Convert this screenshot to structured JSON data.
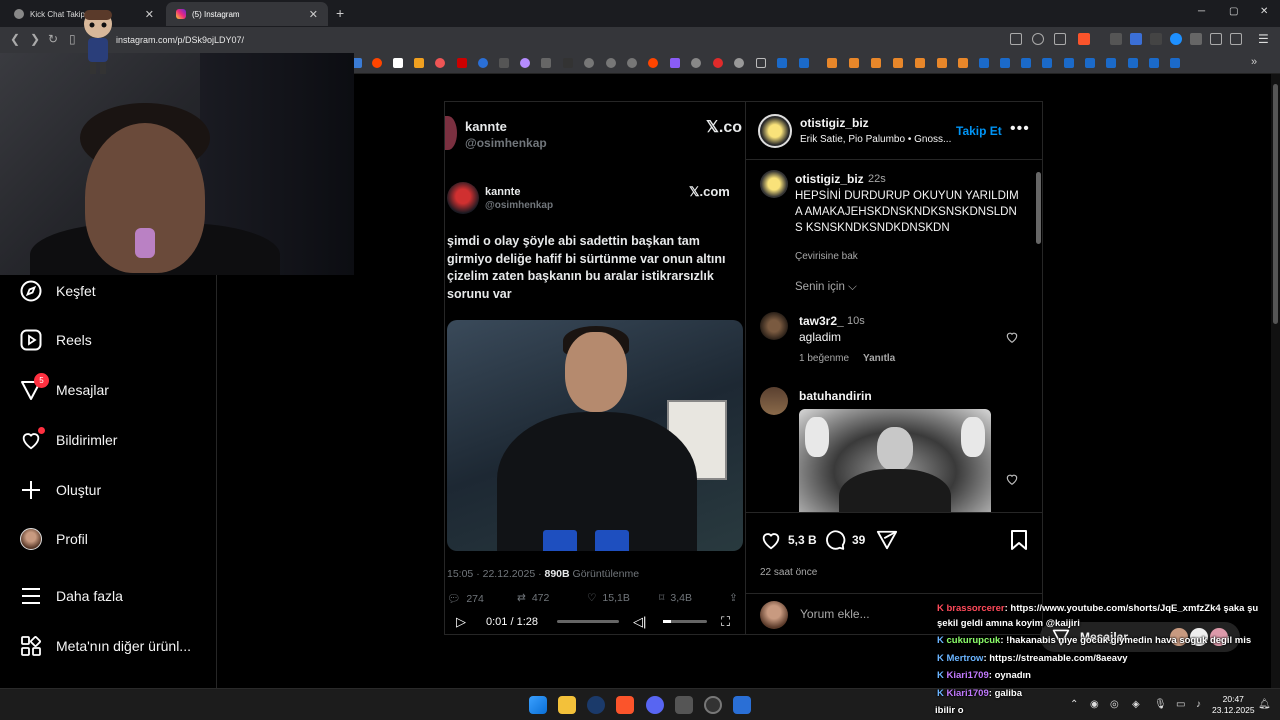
{
  "browser": {
    "tabs": [
      {
        "label": "Kick Chat Takip | W",
        "active": false
      },
      {
        "label": "(5) Instagram",
        "active": true
      }
    ],
    "url": "instagram.com/p/DSk9ojLDY07/",
    "new_tab": "+",
    "win_min": "─",
    "win_max": "▢",
    "win_close": "✕"
  },
  "sidebar": {
    "items": [
      {
        "label": "Keşfet",
        "icon": "compass-icon"
      },
      {
        "label": "Reels",
        "icon": "reels-icon"
      },
      {
        "label": "Mesajlar",
        "icon": "messenger-icon",
        "badge": "5"
      },
      {
        "label": "Bildirimler",
        "icon": "heart-icon"
      },
      {
        "label": "Oluştur",
        "icon": "plus-icon"
      },
      {
        "label": "Profil",
        "icon": "avatar"
      },
      {
        "label": "Daha fazla",
        "icon": "menu-icon"
      },
      {
        "label": "Meta'nın diğer ürünl...",
        "icon": "apps-icon"
      }
    ]
  },
  "media": {
    "top_name": "kannte",
    "top_handle": "@osimhenkap",
    "top_xcom": "𝕏.co",
    "name": "kannte",
    "handle": "@osimhenkap",
    "xcom": "𝕏.com",
    "tweet_text": "şimdi o olay şöyle abi sadettin başkan tam girmiyo deliğe hafif bi sürtünme var onun altını çizelim zaten başkanın bu aralar istikrarsızlık sorunu var",
    "meta_time": "15:05 · 22.12.2025 · ",
    "meta_views": "890B",
    "meta_views_label": " Görüntülenme",
    "stats": {
      "replies": "274",
      "retweets": "472",
      "likes": "15,1B",
      "bookmarks": "3,4B"
    },
    "video_time": "0:01 / 1:28"
  },
  "post": {
    "author": "otistigiz_biz",
    "music": "Erik Satie, Pio Palumbo • Gnoss...",
    "follow": "Takip Et",
    "more": "•••",
    "caption_user": "otistigiz_biz",
    "caption_time": "22s",
    "caption_text": "HEPSİNİ DURDURUP OKUYUN YARILDIMA AMAKAJEHSKDNSKNDKSNSKDNSLDNS KSNSKNDKSNDKDNSKDN",
    "translate": "Çevirisine bak",
    "for_you": "Senin için",
    "comments": [
      {
        "user": "taw3r2_",
        "time": "10s",
        "text": "agladim",
        "likes": "1 beğenme",
        "reply": "Yanıtla"
      },
      {
        "user": "batuhandirin"
      }
    ],
    "likes": "5,3 B",
    "comment_count": "39",
    "time_ago": "22 saat önce",
    "add_comment_placeholder": "Yorum ekle..."
  },
  "chat": {
    "lines": [
      {
        "user": "brassorcerer",
        "color": "#ff4a5a",
        "text": ": https://www.youtube.com/shorts/JqE_xmfzZk4 şaka şu"
      },
      {
        "user": "",
        "color": "#ffffff",
        "text": "şekil geldi amına koyim @kaijiri"
      },
      {
        "user": "cukurupcuk",
        "color": "#8cff6a",
        "text": ": !hakanabis niye gocuk giymedin hava soguk degil mis"
      },
      {
        "user": "Mertrow",
        "color": "#6ab4ff",
        "text": ": https://streamable.com/8aeavy"
      },
      {
        "user": "Kiari1709",
        "color": "#c27aff",
        "text": ": oynadın"
      },
      {
        "user": "Kiari1709",
        "color": "#c27aff",
        "text": ": galiba"
      },
      {
        "user": "",
        "color": "#ffffff",
        "text": "ibilir o"
      }
    ]
  },
  "messages_pill": {
    "label": "Mesajlar"
  },
  "taskbar": {
    "time": "20:47",
    "date": "23.12.2025"
  },
  "colors": {
    "accent": "#0095f6",
    "badge": "#ff3040"
  }
}
